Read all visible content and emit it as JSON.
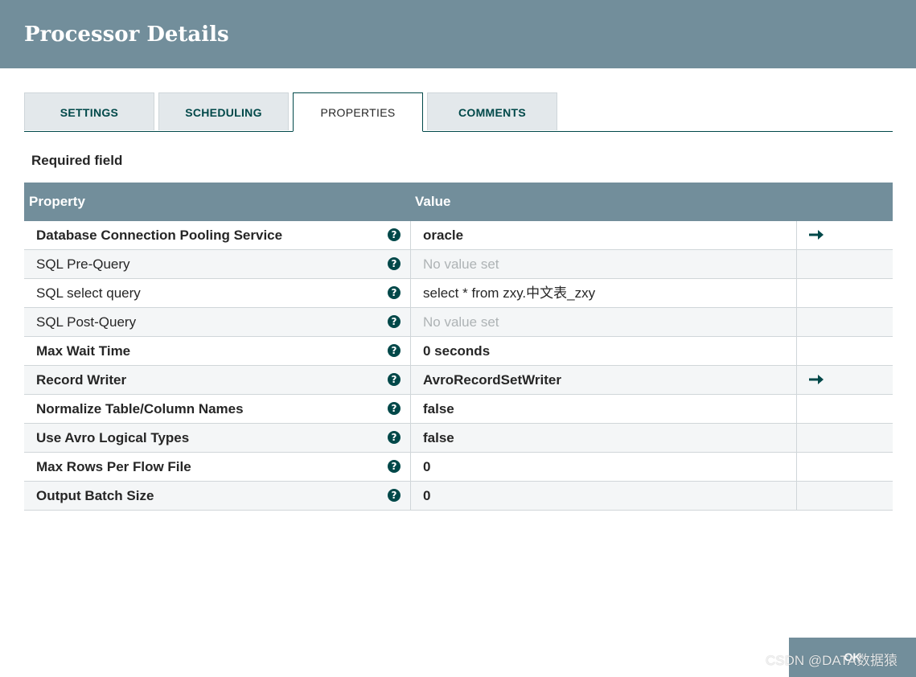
{
  "dialog": {
    "title": "Processor Details"
  },
  "tabs": [
    {
      "label": "SETTINGS",
      "active": false
    },
    {
      "label": "SCHEDULING",
      "active": false
    },
    {
      "label": "PROPERTIES",
      "active": true
    },
    {
      "label": "COMMENTS",
      "active": false
    }
  ],
  "required_label": "Required field",
  "grid": {
    "columns": {
      "property": "Property",
      "value": "Value"
    },
    "rows": [
      {
        "property": "Database Connection Pooling Service",
        "required": true,
        "value": "oracle",
        "value_set": true,
        "has_link": true
      },
      {
        "property": "SQL Pre-Query",
        "required": false,
        "value": "No value set",
        "value_set": false,
        "has_link": false
      },
      {
        "property": "SQL select query",
        "required": false,
        "value": "select * from zxy.中文表_zxy",
        "value_set": true,
        "has_link": false
      },
      {
        "property": "SQL Post-Query",
        "required": false,
        "value": "No value set",
        "value_set": false,
        "has_link": false
      },
      {
        "property": "Max Wait Time",
        "required": true,
        "value": "0 seconds",
        "value_set": true,
        "has_link": false
      },
      {
        "property": "Record Writer",
        "required": true,
        "value": "AvroRecordSetWriter",
        "value_set": true,
        "has_link": true
      },
      {
        "property": "Normalize Table/Column Names",
        "required": true,
        "value": "false",
        "value_set": true,
        "has_link": false
      },
      {
        "property": "Use Avro Logical Types",
        "required": true,
        "value": "false",
        "value_set": true,
        "has_link": false
      },
      {
        "property": "Max Rows Per Flow File",
        "required": true,
        "value": "0",
        "value_set": true,
        "has_link": false
      },
      {
        "property": "Output Batch Size",
        "required": true,
        "value": "0",
        "value_set": true,
        "has_link": false
      }
    ]
  },
  "footer": {
    "ok_label": "OK"
  },
  "watermark": "CSDN @DATA数据猿",
  "colors": {
    "header_bg": "#728e9b",
    "accent": "#004849",
    "alt_row": "#f4f6f7",
    "empty_value": "#aeb3b5"
  },
  "icons": {
    "help": "question-circle-icon",
    "link": "arrow-right-icon"
  }
}
